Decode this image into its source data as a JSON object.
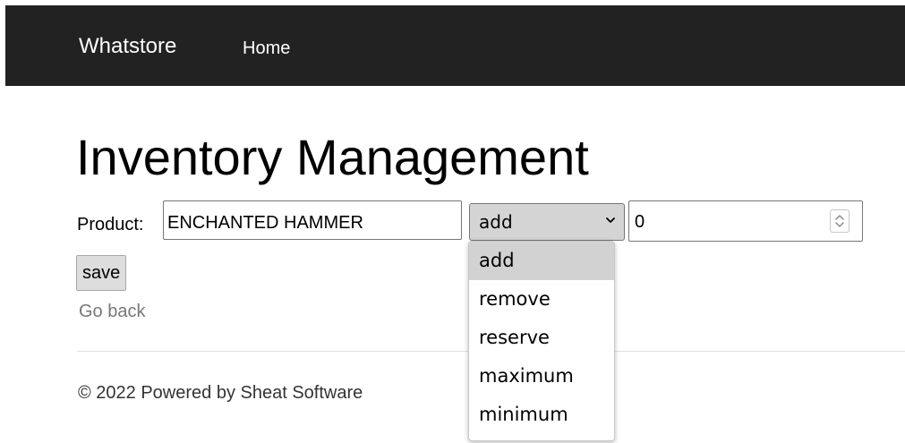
{
  "navbar": {
    "brand": "Whatstore",
    "home_link": "Home",
    "background": "#222222"
  },
  "main": {
    "title": "Inventory Management",
    "product_label": "Product:",
    "product_value": "ENCHANTED HAMMER",
    "operation_selected": "add",
    "quantity_value": "0",
    "save_label": "save",
    "go_back_label": "Go back"
  },
  "dropdown": {
    "options": [
      {
        "label": "add",
        "selected": true
      },
      {
        "label": "remove",
        "selected": false
      },
      {
        "label": "reserve",
        "selected": false
      },
      {
        "label": "maximum",
        "selected": false
      },
      {
        "label": "minimum",
        "selected": false
      }
    ]
  },
  "footer": {
    "text": "© 2022 Powered by Sheat Software"
  },
  "icons": {
    "select_chevron": "chevron-down-icon",
    "number_spinner": "spinner-icon"
  }
}
